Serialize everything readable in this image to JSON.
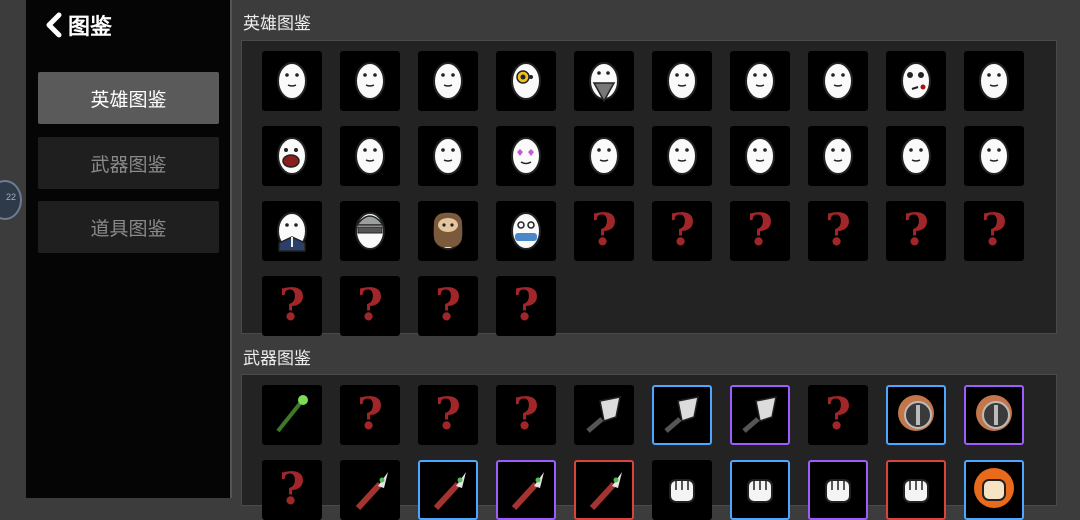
{
  "header": {
    "title": "图鉴"
  },
  "sidebar": {
    "items": [
      {
        "label": "英雄图鉴",
        "active": true
      },
      {
        "label": "武器图鉴",
        "active": false
      },
      {
        "label": "道具图鉴",
        "active": false
      }
    ],
    "handle_text": "22"
  },
  "sections": {
    "heroes": {
      "title": "英雄图鉴",
      "cells": [
        {
          "icon": "egg-hero-icon",
          "unlocked": true
        },
        {
          "icon": "egg-hero-icon",
          "unlocked": true
        },
        {
          "icon": "egg-hero-icon",
          "unlocked": true
        },
        {
          "icon": "egg-hero-yellow-eye-icon",
          "unlocked": true
        },
        {
          "icon": "egg-hero-bearded-icon",
          "unlocked": true
        },
        {
          "icon": "egg-hero-icon",
          "unlocked": true
        },
        {
          "icon": "egg-hero-icon",
          "unlocked": true
        },
        {
          "icon": "egg-hero-icon",
          "unlocked": true
        },
        {
          "icon": "egg-hero-bloody-icon",
          "unlocked": true
        },
        {
          "icon": "egg-hero-icon",
          "unlocked": true
        },
        {
          "icon": "egg-hero-screaming-icon",
          "unlocked": true
        },
        {
          "icon": "egg-hero-icon",
          "unlocked": true
        },
        {
          "icon": "egg-hero-icon",
          "unlocked": true
        },
        {
          "icon": "egg-hero-heart-eyes-icon",
          "unlocked": true
        },
        {
          "icon": "egg-hero-icon",
          "unlocked": true
        },
        {
          "icon": "egg-hero-icon",
          "unlocked": true
        },
        {
          "icon": "egg-hero-icon",
          "unlocked": true
        },
        {
          "icon": "egg-hero-icon",
          "unlocked": true
        },
        {
          "icon": "egg-hero-icon",
          "unlocked": true
        },
        {
          "icon": "egg-hero-icon",
          "unlocked": true
        },
        {
          "icon": "egg-hero-suit-icon",
          "unlocked": true
        },
        {
          "icon": "egg-hero-helmet-icon",
          "unlocked": true
        },
        {
          "icon": "egg-hero-brown-bearded-icon",
          "unlocked": true
        },
        {
          "icon": "egg-hero-masked-icon",
          "unlocked": true
        },
        {
          "icon": "question-mark-icon",
          "unlocked": false
        },
        {
          "icon": "question-mark-icon",
          "unlocked": false
        },
        {
          "icon": "question-mark-icon",
          "unlocked": false
        },
        {
          "icon": "question-mark-icon",
          "unlocked": false
        },
        {
          "icon": "question-mark-icon",
          "unlocked": false
        },
        {
          "icon": "question-mark-icon",
          "unlocked": false
        },
        {
          "icon": "question-mark-icon",
          "unlocked": false
        },
        {
          "icon": "question-mark-icon",
          "unlocked": false
        },
        {
          "icon": "question-mark-icon",
          "unlocked": false
        },
        {
          "icon": "question-mark-icon",
          "unlocked": false
        }
      ]
    },
    "weapons": {
      "title": "武器图鉴",
      "cells": [
        {
          "icon": "green-staff-icon",
          "unlocked": true,
          "rarity": "none"
        },
        {
          "icon": "question-mark-icon",
          "unlocked": false,
          "rarity": "none"
        },
        {
          "icon": "question-mark-icon",
          "unlocked": false,
          "rarity": "none"
        },
        {
          "icon": "question-mark-icon",
          "unlocked": false,
          "rarity": "none"
        },
        {
          "icon": "cleaver-icon",
          "unlocked": true,
          "rarity": "none"
        },
        {
          "icon": "cleaver-icon",
          "unlocked": true,
          "rarity": "blue"
        },
        {
          "icon": "cleaver-icon",
          "unlocked": true,
          "rarity": "purple"
        },
        {
          "icon": "question-mark-icon",
          "unlocked": false,
          "rarity": "none"
        },
        {
          "icon": "saw-blade-icon",
          "unlocked": true,
          "rarity": "blue"
        },
        {
          "icon": "saw-blade-icon",
          "unlocked": true,
          "rarity": "purple"
        },
        {
          "icon": "question-mark-icon",
          "unlocked": false,
          "rarity": "none"
        },
        {
          "icon": "green-knife-icon",
          "unlocked": true,
          "rarity": "none"
        },
        {
          "icon": "green-knife-icon",
          "unlocked": true,
          "rarity": "blue"
        },
        {
          "icon": "green-knife-icon",
          "unlocked": true,
          "rarity": "purple"
        },
        {
          "icon": "green-knife-icon",
          "unlocked": true,
          "rarity": "red"
        },
        {
          "icon": "fist-icon",
          "unlocked": true,
          "rarity": "none"
        },
        {
          "icon": "fist-icon",
          "unlocked": true,
          "rarity": "blue"
        },
        {
          "icon": "fist-icon",
          "unlocked": true,
          "rarity": "purple"
        },
        {
          "icon": "fist-icon",
          "unlocked": true,
          "rarity": "red"
        },
        {
          "icon": "flaming-fist-icon",
          "unlocked": true,
          "rarity": "blue"
        }
      ]
    }
  },
  "colors": {
    "background": "#3c3c3c",
    "sidebar": "#050505",
    "panel": "#232323",
    "rarity_blue": "#4da6ff",
    "rarity_purple": "#9e5cff",
    "rarity_red": "#d9433a",
    "question_mark": "#a0262a"
  }
}
